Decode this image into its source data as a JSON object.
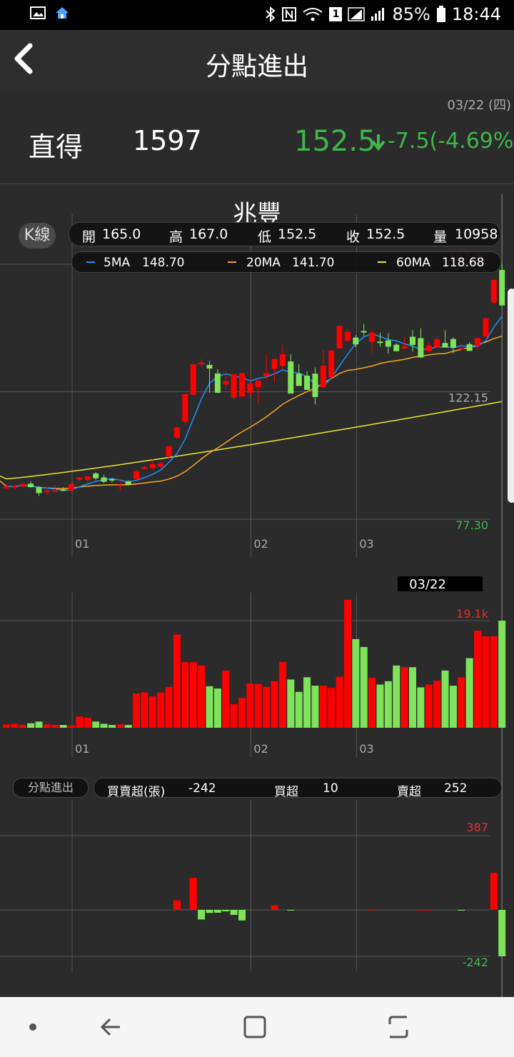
{
  "status_bar": {
    "battery": "85%",
    "time": "18:44",
    "sim_badge": "1"
  },
  "header": {
    "title": "分點進出"
  },
  "date": "03/22 (四)",
  "stock": {
    "broker": "直得",
    "code": "1597",
    "price": "152.5",
    "change": "-7.5(-4.69%)"
  },
  "chart_title": "兆豐",
  "k_pill": "K線",
  "ohlc": {
    "open_label": "開",
    "open": "165.0",
    "high_label": "高",
    "high": "167.0",
    "low_label": "低",
    "low": "152.5",
    "close_label": "收",
    "close": "152.5",
    "vol_label": "量",
    "vol": "10958"
  },
  "ma": {
    "ma5_label": "5MA",
    "ma5": "148.70",
    "ma20_label": "20MA",
    "ma20": "141.70",
    "ma60_label": "60MA",
    "ma60": "118.68"
  },
  "price_axis": {
    "max": "167.00",
    "mid": "122.15",
    "min": "77.30"
  },
  "month_labels": [
    "01",
    "02",
    "03"
  ],
  "cursor_date": "03/22",
  "vol_axis": {
    "max": "19.1k"
  },
  "fn": {
    "pill": "分點進出",
    "net_label": "買賣超(張)",
    "net": "-242",
    "buy_label": "買超",
    "buy": "10",
    "sell_label": "賣超",
    "sell": "252"
  },
  "fn_axis": {
    "max": "387",
    "min": "-242"
  },
  "colors": {
    "up": "#ff0000",
    "down": "#7ee35a",
    "ma5": "#1e8fff",
    "ma20": "#f5a623",
    "ma60": "#e8e82a",
    "price_green": "#3fb64a"
  },
  "chart_data": {
    "type": "candlestick",
    "ma_series": [
      {
        "name": "5MA",
        "last": 148.7
      },
      {
        "name": "20MA",
        "last": 141.7
      },
      {
        "name": "60MA",
        "last": 118.68
      }
    ],
    "candles": [
      {
        "o": 88.2,
        "h": 89.6,
        "l": 87.7,
        "c": 88.8,
        "v": 0.6,
        "net": 0
      },
      {
        "o": 88.4,
        "h": 89.3,
        "l": 87.8,
        "c": 88.9,
        "v": 0.7,
        "net": 0
      },
      {
        "o": 88.9,
        "h": 90.1,
        "l": 88.5,
        "c": 89.7,
        "v": 0.5,
        "net": 0
      },
      {
        "o": 89.8,
        "h": 90.6,
        "l": 88.3,
        "c": 88.6,
        "v": 0.8,
        "net": 0
      },
      {
        "o": 88.6,
        "h": 89.0,
        "l": 85.5,
        "c": 86.5,
        "v": 1.1,
        "net": 0
      },
      {
        "o": 86.8,
        "h": 88.5,
        "l": 86.0,
        "c": 87.4,
        "v": 0.6,
        "net": 0
      },
      {
        "o": 87.4,
        "h": 89.3,
        "l": 86.8,
        "c": 87.4,
        "v": 0.5,
        "net": 0
      },
      {
        "o": 87.8,
        "h": 88.6,
        "l": 87.1,
        "c": 87.3,
        "v": 0.5,
        "net": 0
      },
      {
        "o": 87.4,
        "h": 89.9,
        "l": 86.9,
        "c": 89.7,
        "v": 0.4,
        "net": 0
      },
      {
        "o": 91.2,
        "h": 92.2,
        "l": 90.7,
        "c": 91.9,
        "v": 2.0,
        "net": 0
      },
      {
        "o": 91.2,
        "h": 92.9,
        "l": 90.4,
        "c": 92.4,
        "v": 1.8,
        "net": 0
      },
      {
        "o": 93.4,
        "h": 93.9,
        "l": 91.0,
        "c": 91.7,
        "v": 1.1,
        "net": 0
      },
      {
        "o": 92.0,
        "h": 93.0,
        "l": 90.0,
        "c": 90.5,
        "v": 0.7,
        "net": 0
      },
      {
        "o": 91.4,
        "h": 91.9,
        "l": 90.2,
        "c": 91.2,
        "v": 0.5,
        "net": 0
      },
      {
        "o": 89.3,
        "h": 91.4,
        "l": 87.4,
        "c": 89.4,
        "v": 0.6,
        "net": 0
      },
      {
        "o": 90.6,
        "h": 91.0,
        "l": 89.1,
        "c": 89.5,
        "v": 0.5,
        "net": 0
      },
      {
        "o": 91.4,
        "h": 94.6,
        "l": 91.2,
        "c": 94.2,
        "v": 6.1,
        "net": 0
      },
      {
        "o": 95.0,
        "h": 96.4,
        "l": 94.6,
        "c": 95.6,
        "v": 6.3,
        "net": 0
      },
      {
        "o": 95.3,
        "h": 98.3,
        "l": 94.6,
        "c": 96.7,
        "v": 5.6,
        "net": 0
      },
      {
        "o": 95.8,
        "h": 97.6,
        "l": 95.2,
        "c": 97.0,
        "v": 6.3,
        "net": 0
      },
      {
        "o": 99.5,
        "h": 101.1,
        "l": 98.3,
        "c": 103.0,
        "v": 7.3,
        "net": 0
      },
      {
        "o": 106.0,
        "h": 107.7,
        "l": 105.5,
        "c": 109.6,
        "v": 16.6,
        "net": 50
      },
      {
        "o": 111.6,
        "h": 114.4,
        "l": 110.5,
        "c": 121.3,
        "v": 11.7,
        "net": 4
      },
      {
        "o": 121.1,
        "h": 126.8,
        "l": 120.8,
        "c": 131.8,
        "v": 11.7,
        "net": 167
      },
      {
        "o": 131.8,
        "h": 133.6,
        "l": 130.6,
        "c": 132.4,
        "v": 11.1,
        "net": -50
      },
      {
        "o": 131.6,
        "h": 133.0,
        "l": 121.8,
        "c": 130.3,
        "v": 7.4,
        "net": -16
      },
      {
        "o": 128.6,
        "h": 130.1,
        "l": 121.6,
        "c": 121.8,
        "v": 7.0,
        "net": -15
      },
      {
        "o": 124.7,
        "h": 129.4,
        "l": 122.9,
        "c": 125.9,
        "v": 10.2,
        "net": -8
      },
      {
        "o": 120.1,
        "h": 128.3,
        "l": 119.4,
        "c": 128.3,
        "v": 4.2,
        "net": -26
      },
      {
        "o": 120.5,
        "h": 122.5,
        "l": 120.3,
        "c": 128.7,
        "v": 5.3,
        "net": -55
      },
      {
        "o": 121.8,
        "h": 126.4,
        "l": 120.0,
        "c": 125.1,
        "v": 7.9,
        "net": 0
      },
      {
        "o": 123.8,
        "h": 125.3,
        "l": 118.0,
        "c": 126.1,
        "v": 7.8,
        "net": 0
      },
      {
        "o": 127.7,
        "h": 135.3,
        "l": 126.4,
        "c": 128.7,
        "v": 7.3,
        "net": 0
      },
      {
        "o": 130.2,
        "h": 131.3,
        "l": 125.4,
        "c": 133.7,
        "v": 8.3,
        "net": 23
      },
      {
        "o": 131.3,
        "h": 138.6,
        "l": 129.9,
        "c": 135.3,
        "v": 11.7,
        "net": 0
      },
      {
        "o": 132.8,
        "h": 135.3,
        "l": 129.2,
        "c": 121.5,
        "v": 8.6,
        "net": -1
      },
      {
        "o": 128.5,
        "h": 131.8,
        "l": 124.2,
        "c": 124.2,
        "v": 6.4,
        "net": 0
      },
      {
        "o": 127.8,
        "h": 129.4,
        "l": 125.5,
        "c": 122.8,
        "v": 9.0,
        "net": 0
      },
      {
        "o": 128.5,
        "h": 130.7,
        "l": 117.7,
        "c": 120.3,
        "v": 7.5,
        "net": 0
      },
      {
        "o": 123.7,
        "h": 136.9,
        "l": 123.4,
        "c": 131.3,
        "v": 7.5,
        "net": 0
      },
      {
        "o": 127.3,
        "h": 132.2,
        "l": 126.4,
        "c": 136.7,
        "v": 7.1,
        "net": 0
      },
      {
        "o": 137.4,
        "h": 145.5,
        "l": 137.4,
        "c": 145.3,
        "v": 9.1,
        "net": 0
      },
      {
        "o": 140.1,
        "h": 144.4,
        "l": 139.6,
        "c": 143.2,
        "v": 22.8,
        "net": 0
      },
      {
        "o": 141.2,
        "h": 142.1,
        "l": 137.8,
        "c": 138.8,
        "v": 15.8,
        "net": 0
      },
      {
        "o": 143.5,
        "h": 146.0,
        "l": 141.7,
        "c": 143.1,
        "v": 14.4,
        "net": 0
      },
      {
        "o": 139.7,
        "h": 143.5,
        "l": 135.8,
        "c": 143.0,
        "v": 8.9,
        "net": 1
      },
      {
        "o": 139.8,
        "h": 142.9,
        "l": 138.0,
        "c": 139.6,
        "v": 7.7,
        "net": 0
      },
      {
        "o": 140.2,
        "h": 142.7,
        "l": 135.6,
        "c": 138.0,
        "v": 8.3,
        "net": 0
      },
      {
        "o": 138.7,
        "h": 139.2,
        "l": 137.3,
        "c": 136.4,
        "v": 11.1,
        "net": 0
      },
      {
        "o": 137.3,
        "h": 141.4,
        "l": 137.3,
        "c": 138.1,
        "v": 10.8,
        "net": 0
      },
      {
        "o": 141.5,
        "h": 143.9,
        "l": 136.2,
        "c": 138.6,
        "v": 10.8,
        "net": 0
      },
      {
        "o": 141.0,
        "h": 144.5,
        "l": 134.0,
        "c": 134.2,
        "v": 7.2,
        "net": 1
      },
      {
        "o": 136.4,
        "h": 139.8,
        "l": 136.1,
        "c": 138.4,
        "v": 7.7,
        "net": 1
      },
      {
        "o": 137.7,
        "h": 141.6,
        "l": 137.5,
        "c": 140.5,
        "v": 8.4,
        "net": 0
      },
      {
        "o": 139.3,
        "h": 143.8,
        "l": 138.6,
        "c": 137.7,
        "v": 10.2,
        "net": 0
      },
      {
        "o": 140.7,
        "h": 141.3,
        "l": 135.6,
        "c": 137.6,
        "v": 7.5,
        "net": 0
      },
      {
        "o": 137.0,
        "h": 139.1,
        "l": 136.6,
        "c": 137.5,
        "v": 9.0,
        "net": -1
      },
      {
        "o": 138.9,
        "h": 139.6,
        "l": 137.0,
        "c": 136.5,
        "v": 12.4,
        "net": 0
      },
      {
        "o": 138.1,
        "h": 140.4,
        "l": 137.0,
        "c": 141.0,
        "v": 17.3,
        "net": 0
      },
      {
        "o": 141.6,
        "h": 148.4,
        "l": 141.4,
        "c": 148.0,
        "v": 16.3,
        "net": 0
      },
      {
        "o": 153.5,
        "h": 161.9,
        "l": 152.8,
        "c": 161.5,
        "v": 16.3,
        "net": 193
      },
      {
        "o": 165.0,
        "h": 167.0,
        "l": 152.5,
        "c": 152.5,
        "v": 19.1,
        "net": -242
      }
    ]
  }
}
